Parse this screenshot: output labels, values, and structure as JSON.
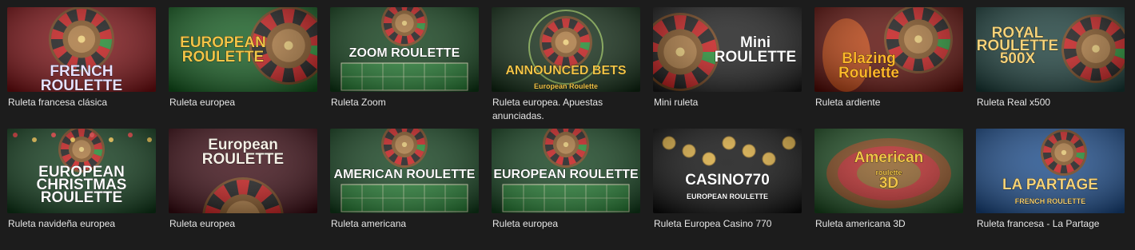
{
  "games": [
    {
      "caption": "Ruleta francesa clásica",
      "logo": [
        "FRENCH",
        "ROULETTE"
      ],
      "bg": "#7a0e12",
      "accent": "#e8e1ff",
      "style": "wheel-center"
    },
    {
      "caption": "Ruleta europea",
      "logo": [
        "EUROPEAN",
        "ROULETTE"
      ],
      "bg": "#135c1f",
      "accent": "#f2c548",
      "style": "wheel-right"
    },
    {
      "caption": "Ruleta Zoom",
      "logo": [
        "ZOOM ROULETTE"
      ],
      "bg": "#0f3d18",
      "accent": "#ffffff",
      "style": "table"
    },
    {
      "caption": "Ruleta europea. Apuestas anunciadas.",
      "logo": [
        "ANNOUNCED BETS",
        "European Roulette"
      ],
      "bg": "#102a14",
      "accent": "#f2c548",
      "style": "wheel-glow"
    },
    {
      "caption": "Mini ruleta",
      "logo": [
        "Mini",
        "ROULETTE"
      ],
      "bg": "#1a1a1a",
      "accent": "#ffffff",
      "style": "wheel-left"
    },
    {
      "caption": "Ruleta ardiente",
      "logo": [
        "Blazing",
        "Roulette"
      ],
      "bg": "#5a0b06",
      "accent": "#ffb72a",
      "style": "fire"
    },
    {
      "caption": "Ruleta Real x500",
      "logo": [
        "ROYAL",
        "ROULETTE",
        "500X"
      ],
      "bg": "#1a3d3a",
      "accent": "#f4d27a",
      "style": "royal"
    },
    {
      "caption": "Ruleta navideña europea",
      "logo": [
        "EUROPEAN",
        "CHRISTMAS",
        "ROULETTE"
      ],
      "bg": "#0f3a1a",
      "accent": "#ffffff",
      "style": "xmas"
    },
    {
      "caption": "Ruleta europea",
      "logo": [
        "European",
        "ROULETTE"
      ],
      "bg": "#3a0a12",
      "accent": "#f6f0e6",
      "style": "wheel-bottom"
    },
    {
      "caption": "Ruleta americana",
      "logo": [
        "AMERICAN ROULETTE"
      ],
      "bg": "#12401d",
      "accent": "#ffffff",
      "style": "table"
    },
    {
      "caption": "Ruleta europea",
      "logo": [
        "EUROPEAN ROULETTE"
      ],
      "bg": "#12401d",
      "accent": "#ffffff",
      "style": "table"
    },
    {
      "caption": "Ruleta Europea Casino 770",
      "logo": [
        "CASINO770",
        "EUROPEAN ROULETTE"
      ],
      "bg": "#0c0c0c",
      "accent": "#ffffff",
      "style": "casino"
    },
    {
      "caption": "Ruleta americana 3D",
      "logo": [
        "American",
        "roulette",
        "3D"
      ],
      "bg": "#1a4a1f",
      "accent": "#f2c548",
      "style": "am3d"
    },
    {
      "caption": "Ruleta francesa - La Partage",
      "logo": [
        "LA PARTAGE",
        "FRENCH ROULETTE"
      ],
      "bg": "#143a6a",
      "accent": "#f4d27a",
      "style": "partage"
    }
  ]
}
